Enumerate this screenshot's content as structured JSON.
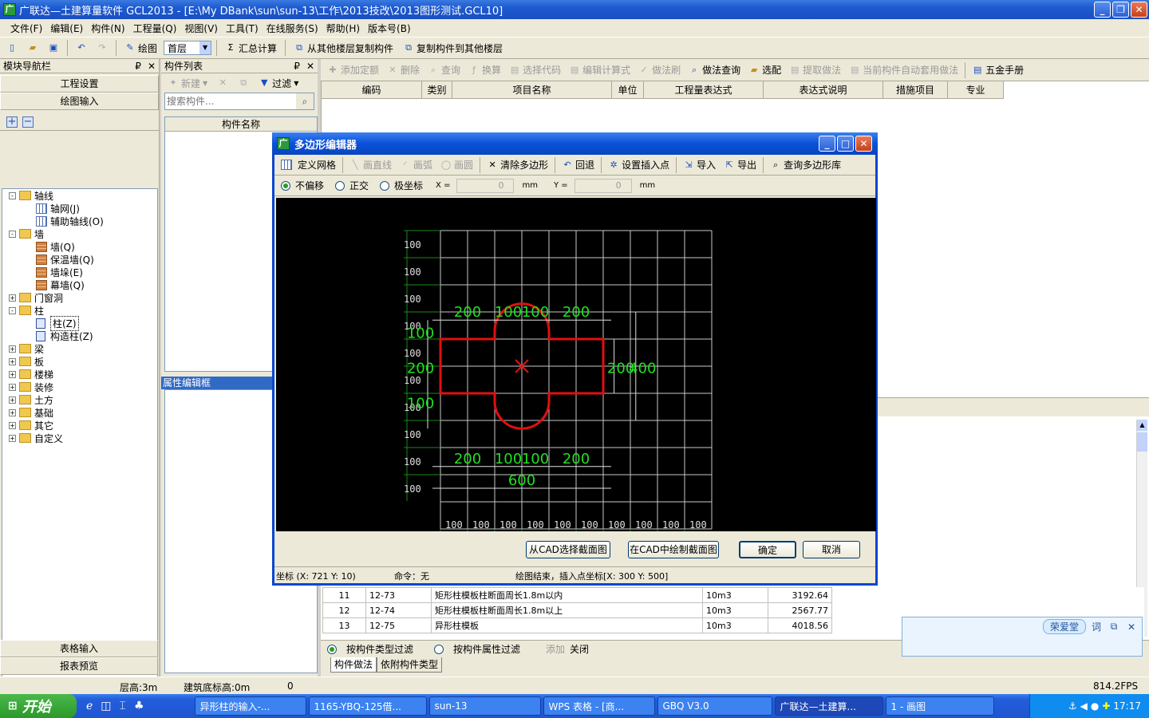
{
  "window": {
    "title": "广联达—土建算量软件 GCL2013 - [E:\\My DBank\\sun\\sun-13\\工作\\2013技改\\2013图形测试.GCL10]",
    "minimize": "_",
    "maximize": "❐",
    "close": "✕"
  },
  "menu": [
    "文件(F)",
    "编辑(E)",
    "构件(N)",
    "工程量(Q)",
    "视图(V)",
    "工具(T)",
    "在线服务(S)",
    "帮助(H)",
    "版本号(B)"
  ],
  "toolbar": {
    "draw": "绘图",
    "floor": "首层",
    "sum": "汇总计算",
    "copy_from": "从其他楼层复制构件",
    "copy_to": "复制构件到其他楼层"
  },
  "nav": {
    "title": "模块导航栏",
    "pin": "₽",
    "close": "✕",
    "project_settings": "工程设置",
    "draw_input": "绘图输入",
    "table_input": "表格输入",
    "report_preview": "报表预览",
    "tree": [
      {
        "label": "轴线",
        "level": 0,
        "type": "folder",
        "exp": "-"
      },
      {
        "label": "轴网(J)",
        "level": 1,
        "type": "grid"
      },
      {
        "label": "辅助轴线(O)",
        "level": 1,
        "type": "grid"
      },
      {
        "label": "墙",
        "level": 0,
        "type": "folder",
        "exp": "-"
      },
      {
        "label": "墙(Q)",
        "level": 1,
        "type": "wall"
      },
      {
        "label": "保温墙(Q)",
        "level": 1,
        "type": "wall"
      },
      {
        "label": "墙垛(E)",
        "level": 1,
        "type": "wall"
      },
      {
        "label": "幕墙(Q)",
        "level": 1,
        "type": "wall"
      },
      {
        "label": "门窗洞",
        "level": 0,
        "type": "folder",
        "exp": "+"
      },
      {
        "label": "柱",
        "level": 0,
        "type": "folder",
        "exp": "-"
      },
      {
        "label": "柱(Z)",
        "level": 1,
        "type": "col"
      },
      {
        "label": "构造柱(Z)",
        "level": 1,
        "type": "col"
      },
      {
        "label": "梁",
        "level": 0,
        "type": "folder",
        "exp": "+"
      },
      {
        "label": "板",
        "level": 0,
        "type": "folder",
        "exp": "+"
      },
      {
        "label": "楼梯",
        "level": 0,
        "type": "folder",
        "exp": "+"
      },
      {
        "label": "装修",
        "level": 0,
        "type": "folder",
        "exp": "+"
      },
      {
        "label": "土方",
        "level": 0,
        "type": "folder",
        "exp": "+"
      },
      {
        "label": "基础",
        "level": 0,
        "type": "folder",
        "exp": "+"
      },
      {
        "label": "其它",
        "level": 0,
        "type": "folder",
        "exp": "+"
      },
      {
        "label": "自定义",
        "level": 0,
        "type": "folder",
        "exp": "+"
      }
    ]
  },
  "complist": {
    "title": "构件列表",
    "new": "新建",
    "filter": "过滤",
    "search_placeholder": "搜索构件...",
    "col_name": "构件名称",
    "props_title": "属性编辑框"
  },
  "right_toolbar": {
    "add_quota": "添加定额",
    "delete": "删除",
    "query": "查询",
    "convert": "换算",
    "select_code": "选择代码",
    "edit_formula": "编辑计算式",
    "method_brush": "做法刷",
    "method_query": "做法查询",
    "select_match": "选配",
    "extract": "提取做法",
    "auto_apply": "当前构件自动套用做法",
    "hardware": "五金手册"
  },
  "grid_headers": [
    "编码",
    "类别",
    "项目名称",
    "单位",
    "工程量表达式",
    "表达式说明",
    "措施项目",
    "专业"
  ],
  "lower_rows": [
    {
      "no": "11",
      "code": "12-73",
      "name": "矩形柱模板柱断面周长1.8m以内",
      "unit": "10m3",
      "qty": "3192.64"
    },
    {
      "no": "12",
      "code": "12-74",
      "name": "矩形柱模板柱断面周长1.8m以上",
      "unit": "10m3",
      "qty": "2567.77"
    },
    {
      "no": "13",
      "code": "12-75",
      "name": "异形柱模板",
      "unit": "10m3",
      "qty": "4018.56"
    }
  ],
  "lower_filter": {
    "by_type": "按构件类型过滤",
    "by_prop": "按构件属性过滤",
    "add": "添加",
    "close": "关闭",
    "tab1": "构件做法",
    "tab2": "依附构件类型"
  },
  "dialog": {
    "title": "多边形编辑器",
    "define_grid": "定义网格",
    "draw_line": "画直线",
    "draw_arc": "画弧",
    "draw_circle": "画圆",
    "clear_polygon": "清除多边形",
    "undo": "回退",
    "set_insert": "设置插入点",
    "import": "导入",
    "export": "导出",
    "query_lib": "查询多边形库",
    "opt_no_offset": "不偏移",
    "opt_ortho": "正交",
    "opt_polar": "极坐标",
    "x_label": "X =",
    "x_value": "0",
    "y_label": "Y =",
    "y_value": "0",
    "unit": "mm",
    "btn_from_cad": "从CAD选择截面图",
    "btn_draw_cad": "在CAD中绘制截面图",
    "btn_ok": "确定",
    "btn_cancel": "取消",
    "status_coord": "坐标 (X: 721 Y: 10)",
    "status_cmd": "命令：无",
    "status_msg": "绘图结束，插入点坐标[X: 300 Y: 500]"
  },
  "canvas": {
    "left_labels": [
      "100",
      "100",
      "100",
      "100",
      "100",
      "100",
      "100",
      "100",
      "100",
      "100"
    ],
    "bottom_labels": [
      "100",
      "100",
      "100",
      "100",
      "100",
      "100",
      "100",
      "100",
      "100",
      "100"
    ],
    "dim_top": [
      "200",
      "100",
      "100",
      "200"
    ],
    "dim_bottom": [
      "200",
      "100",
      "100",
      "200"
    ],
    "dim_total": "600",
    "dim_left_top": "100",
    "dim_left_mid": "200",
    "dim_left_bot": "100",
    "dim_right_inner": "200",
    "dim_right_outer": "400",
    "shape_color": "#e01010",
    "dim_color": "#20e020"
  },
  "chat": {
    "name": "荣爱堂",
    "btns": [
      "词",
      "⧉",
      "✕"
    ]
  },
  "status": {
    "floor_height": "层高:3m",
    "base_height": "建筑底标高:0m",
    "zero": "0",
    "fps": "814.2FPS"
  },
  "taskbar": {
    "start": "开始",
    "tasks": [
      "异形柱的输入-...",
      "1165-YBQ-125借...",
      "sun-13",
      "WPS 表格 - [商...",
      "GBQ V3.0",
      "广联达—土建算...",
      "1 - 画图"
    ],
    "clock": "17:17"
  }
}
